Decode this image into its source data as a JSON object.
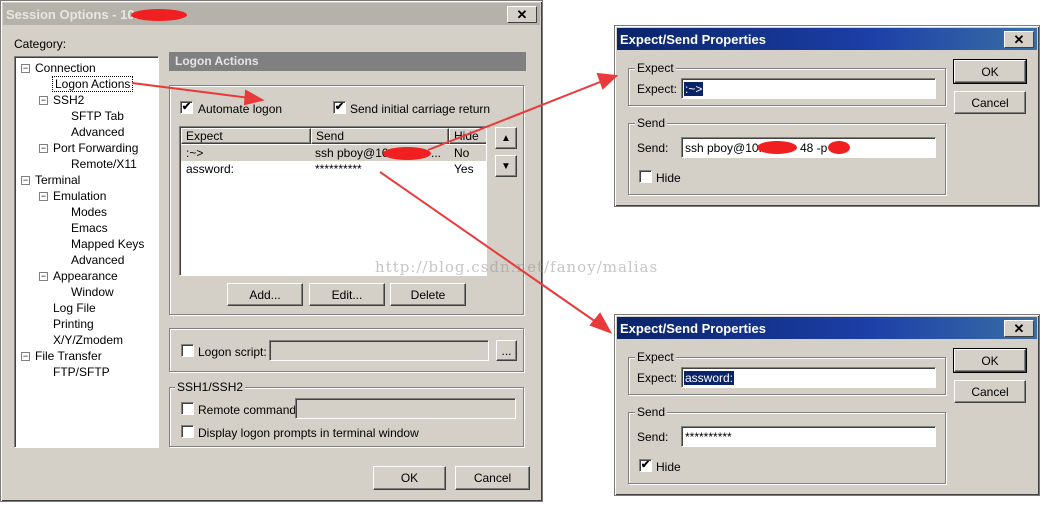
{
  "session_options": {
    "title": "Session Options - 10.",
    "close": "✕",
    "category_label": "Category:",
    "section_header": "Logon Actions",
    "tree": [
      {
        "label": "Connection",
        "indent": 0,
        "expander": "−"
      },
      {
        "label": "Logon Actions",
        "indent": 1,
        "selected": true
      },
      {
        "label": "SSH2",
        "indent": 1,
        "expander": "−"
      },
      {
        "label": "SFTP Tab",
        "indent": 2
      },
      {
        "label": "Advanced",
        "indent": 2
      },
      {
        "label": "Port Forwarding",
        "indent": 1,
        "expander": "−"
      },
      {
        "label": "Remote/X11",
        "indent": 2
      },
      {
        "label": "Terminal",
        "indent": 0,
        "expander": "−"
      },
      {
        "label": "Emulation",
        "indent": 1,
        "expander": "−"
      },
      {
        "label": "Modes",
        "indent": 2
      },
      {
        "label": "Emacs",
        "indent": 2
      },
      {
        "label": "Mapped Keys",
        "indent": 2
      },
      {
        "label": "Advanced",
        "indent": 2
      },
      {
        "label": "Appearance",
        "indent": 1,
        "expander": "−"
      },
      {
        "label": "Window",
        "indent": 2
      },
      {
        "label": "Log File",
        "indent": 1
      },
      {
        "label": "Printing",
        "indent": 1
      },
      {
        "label": "X/Y/Zmodem",
        "indent": 1
      },
      {
        "label": "File Transfer",
        "indent": 0,
        "expander": "−"
      },
      {
        "label": "FTP/SFTP",
        "indent": 1
      }
    ],
    "automate_logon": "Automate logon",
    "automate_checked": "✔",
    "send_cr": "Send initial carriage return",
    "send_cr_checked": "✔",
    "columns": [
      "Expect",
      "Send",
      "Hide"
    ],
    "rows": [
      {
        "expect": ":~>",
        "send": "ssh pboy@10.",
        "hide": "No"
      },
      {
        "expect": "assword:",
        "send": "**********",
        "hide": "Yes"
      }
    ],
    "add": "Add...",
    "edit": "Edit...",
    "delete": "Delete",
    "logon_script": "Logon script:",
    "browse": "...",
    "ssh_group": "SSH1/SSH2",
    "remote_command": "Remote command:",
    "display_prompts": "Display logon prompts in terminal window",
    "ok": "OK",
    "cancel": "Cancel",
    "up_icon": "▲",
    "down_icon": "▼"
  },
  "dialog1": {
    "title": "Expect/Send Properties",
    "close": "✕",
    "expect_group": "Expect",
    "expect_label": "Expect:",
    "expect_value": ":~>",
    "send_group": "Send",
    "send_label": "Send:",
    "send_value": "ssh pboy@10.",
    "send_value_tail": "48 -p",
    "hide_label": "Hide",
    "hide_checked": "",
    "ok": "OK",
    "cancel": "Cancel"
  },
  "dialog2": {
    "title": "Expect/Send Properties",
    "close": "✕",
    "expect_group": "Expect",
    "expect_label": "Expect:",
    "expect_value": "assword:",
    "send_group": "Send",
    "send_label": "Send:",
    "send_value": "**********",
    "hide_label": "Hide",
    "hide_checked": "✔",
    "ok": "OK",
    "cancel": "Cancel"
  },
  "watermark": "http://blog.csdn.net/fanoy/malias",
  "colors": {
    "annotation_arrow": "#e83a3a",
    "selection": "#0a246a",
    "redaction": "#f02020"
  }
}
